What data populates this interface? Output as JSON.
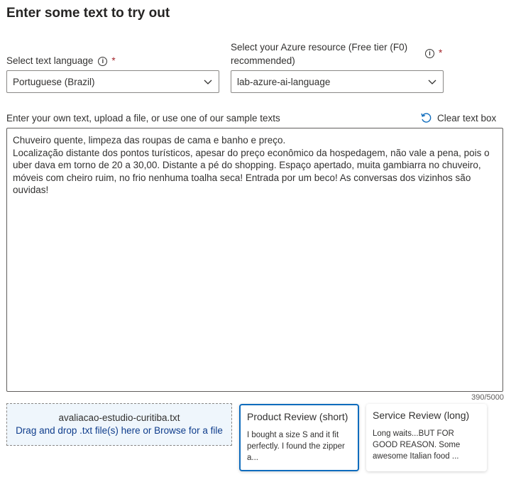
{
  "page_title": "Enter some text to try out",
  "language": {
    "label": "Select text language",
    "required_mark": "*",
    "info_icon": "info-icon",
    "selected": "Portuguese (Brazil)"
  },
  "resource": {
    "label_line1": "Select your Azure resource (Free tier (F0)",
    "label_line2": "recommended)",
    "required_mark": "*",
    "info_icon": "info-icon",
    "selected": "lab-azure-ai-language"
  },
  "text_section": {
    "instructions": "Enter your own text, upload a file, or use one of our sample texts",
    "clear_label": "Clear text box",
    "clear_icon": "refresh-icon",
    "content": "Chuveiro quente, limpeza das roupas de cama e banho e preço.\nLocalização distante dos pontos turísticos, apesar do preço econômico da hospedagem, não vale a pena, pois o uber dava em torno de 20 a 30,00. Distante a pé do shopping. Espaço apertado, muita gambiarra no chuveiro, móveis com cheiro ruim, no frio nenhuma toalha seca! Entrada por um beco! As conversas dos vizinhos são ouvidas!",
    "char_count": "390/5000"
  },
  "upload": {
    "file_name": "avaliacao-estudio-curitiba.txt",
    "prompt": "Drag and drop .txt file(s) here or Browse for a file"
  },
  "samples": [
    {
      "title": "Product Review (short)",
      "preview": "I bought a size S and it fit perfectly. I found the zipper a...",
      "selected": true
    },
    {
      "title": "Service Review (long)",
      "preview": "Long waits...BUT FOR GOOD REASON. Some awesome Italian food ...",
      "selected": false
    }
  ],
  "colors": {
    "required": "#a4262c",
    "accent": "#0f6cbd",
    "link": "#0f3d8c",
    "dropzone_bg": "#eff6fc"
  }
}
